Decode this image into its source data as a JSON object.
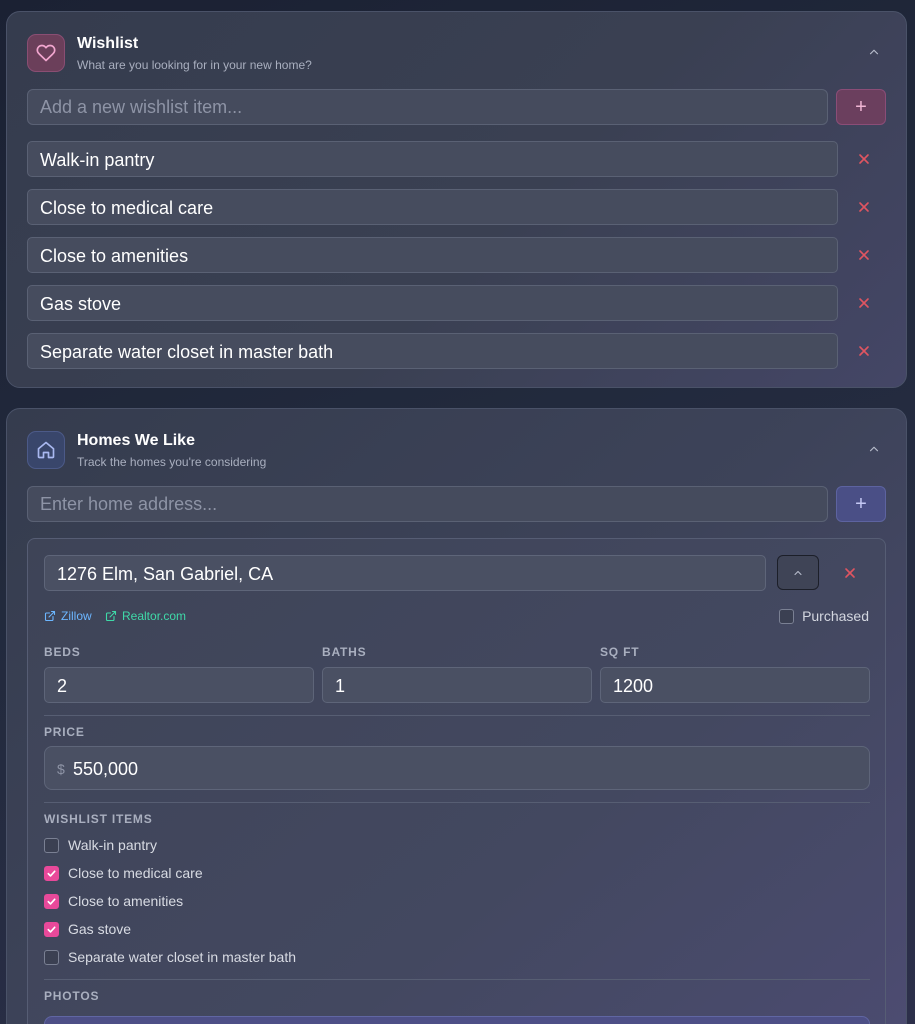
{
  "wishlist": {
    "title": "Wishlist",
    "subtitle": "What are you looking for in your new home?",
    "input_placeholder": "Add a new wishlist item...",
    "add_label": "+",
    "items": [
      {
        "label": "Walk-in pantry"
      },
      {
        "label": "Close to medical care"
      },
      {
        "label": "Close to amenities"
      },
      {
        "label": "Gas stove"
      },
      {
        "label": "Separate water closet in master bath"
      }
    ],
    "accent_color": "#e8499a"
  },
  "homes": {
    "title": "Homes We Like",
    "subtitle": "Track the homes you're considering",
    "input_placeholder": "Enter home address...",
    "add_label": "+",
    "list": [
      {
        "address": "1276 Elm, San Gabriel, CA",
        "links": {
          "zillow": "Zillow",
          "realtor": "Realtor.com"
        },
        "purchased_label": "Purchased",
        "purchased": false,
        "beds_label": "BEDS",
        "beds": "2",
        "baths_label": "BATHS",
        "baths": "1",
        "sqft_label": "SQ FT",
        "sqft": "1200",
        "price_label": "PRICE",
        "currency": "$",
        "price": "550,000",
        "wishlist_label": "WISHLIST ITEMS",
        "wishlist_checks": [
          {
            "label": "Walk-in pantry",
            "checked": false
          },
          {
            "label": "Close to medical care",
            "checked": true
          },
          {
            "label": "Close to amenities",
            "checked": true
          },
          {
            "label": "Gas stove",
            "checked": true
          },
          {
            "label": "Separate water closet in master bath",
            "checked": false
          }
        ],
        "photos_label": "PHOTOS"
      }
    ]
  },
  "icons": {
    "wishlist_header": "heart-icon",
    "homes_header": "home-icon",
    "collapse": "chevron-up-icon",
    "remove": "close-icon",
    "external_link": "external-link-icon",
    "check": "check-icon"
  },
  "colors": {
    "remove": "#e05561",
    "zillow_link": "#6cb6ff",
    "realtor_link": "#3fd9a8",
    "checked": "#e8499a"
  }
}
